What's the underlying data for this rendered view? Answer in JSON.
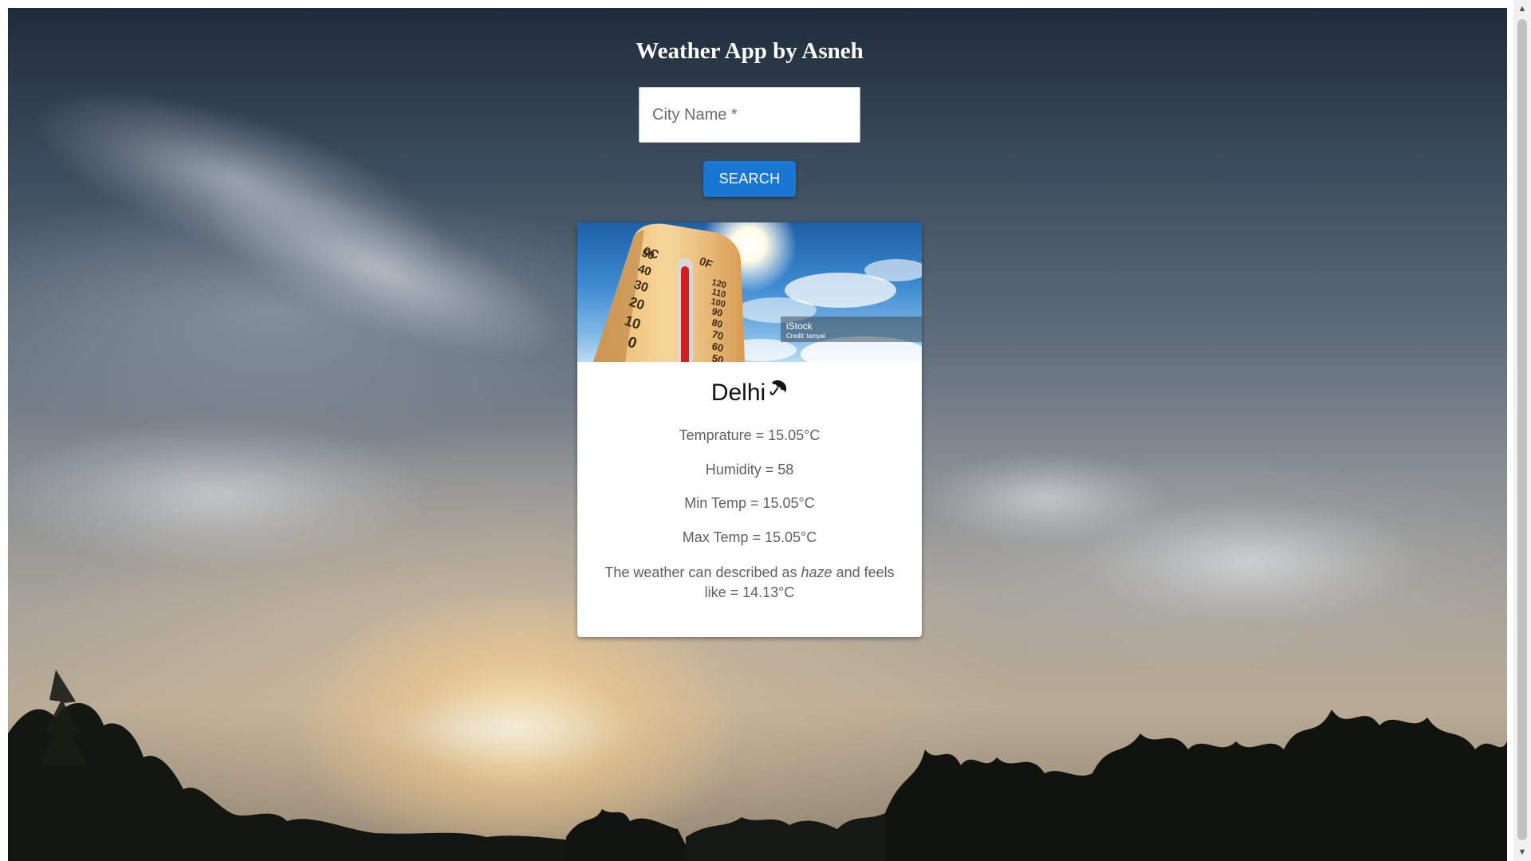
{
  "header": {
    "title": "Weather App by Asneh"
  },
  "search": {
    "placeholder": "City Name *",
    "value": "",
    "button_label": "SEARCH"
  },
  "card": {
    "image": {
      "scale_c": [
        "0C",
        "50",
        "40",
        "30",
        "20",
        "10",
        "0"
      ],
      "scale_f": [
        "0F",
        "120",
        "110",
        "100",
        "90",
        "80",
        "70",
        "60",
        "50"
      ],
      "watermark_brand": "iStock",
      "watermark_credit": "Credit: lamyai"
    },
    "city": "Delhi",
    "icon": "umbrella-icon",
    "temperature": "Temprature = 15.05°C",
    "humidity": "Humidity = 58",
    "min_temp": "Min Temp = 15.05°C",
    "max_temp": "Max Temp = 15.05°C",
    "description_prefix": "The weather can described as ",
    "description_condition": "haze",
    "description_suffix": " and feels like = 14.13°C"
  },
  "colors": {
    "button": "#1976d2",
    "card_text": "#5f5f5f",
    "title": "#ffffff"
  }
}
